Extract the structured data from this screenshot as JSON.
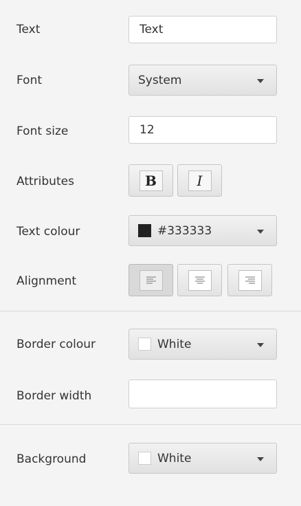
{
  "text": {
    "label": "Text",
    "value": "Text"
  },
  "font": {
    "label": "Font",
    "value": "System"
  },
  "font_size": {
    "label": "Font size",
    "value": "12"
  },
  "attributes": {
    "label": "Attributes",
    "bold_icon": "bold-icon",
    "italic_icon": "italic-icon"
  },
  "text_colour": {
    "label": "Text colour",
    "value": "#333333",
    "swatch_color": "#222222"
  },
  "alignment": {
    "label": "Alignment",
    "options": [
      "left",
      "center",
      "right"
    ],
    "selected": "left"
  },
  "border_colour": {
    "label": "Border colour",
    "value": "White",
    "swatch_color": "#ffffff"
  },
  "border_width": {
    "label": "Border width",
    "value": ""
  },
  "background": {
    "label": "Background",
    "value": "White",
    "swatch_color": "#ffffff"
  }
}
